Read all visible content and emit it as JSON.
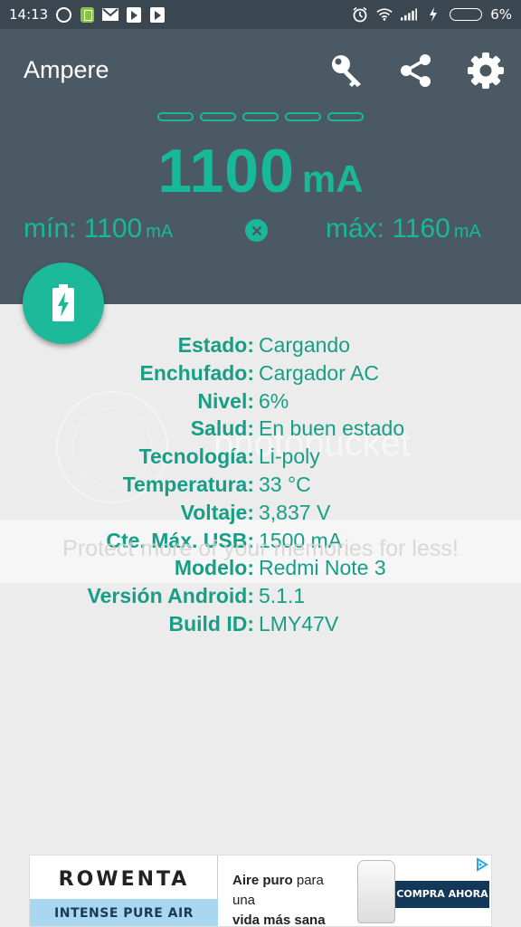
{
  "status_bar": {
    "time": "14:13",
    "battery_percent": "6%"
  },
  "app": {
    "title": "Ampere"
  },
  "current": {
    "value": "1100",
    "unit": "mA",
    "min_label": "mín: 1100",
    "max_label": "máx: 1160",
    "min_unit": "mA",
    "max_unit": "mA",
    "segments_lit": 0,
    "segments_total": 5
  },
  "info_rows": [
    {
      "label": "Estado:",
      "value": "Cargando"
    },
    {
      "label": "Enchufado:",
      "value": "Cargador AC"
    },
    {
      "label": "Nivel:",
      "value": "6%"
    },
    {
      "label": "Salud:",
      "value": "En buen estado"
    },
    {
      "label": "Tecnología:",
      "value": "Li-poly"
    },
    {
      "label": "Temperatura:",
      "value": "33 °C"
    },
    {
      "label": "Voltaje:",
      "value": "3,837 V"
    },
    {
      "label": "Cte. Máx. USB:",
      "value": "1500 mA"
    },
    {
      "label": "Modelo:",
      "value": "Redmi Note 3"
    },
    {
      "label": "Versión Android:",
      "value": "5.1.1"
    },
    {
      "label": "Build ID:",
      "value": "LMY47V"
    }
  ],
  "watermark": {
    "brand": "photobucket",
    "tagline": "Protect more of your memories for less!"
  },
  "ad": {
    "brand": "ROWENTA",
    "product_line": "INTENSE PURE AIR",
    "copy_line1_bold": "Aire puro",
    "copy_line1_rest": " para una",
    "copy_line2": "vida más sana",
    "cta": "COMPRA AHORA"
  },
  "colors": {
    "accent": "#18b89a",
    "header_bg": "#4a5964",
    "status_bg": "#3b4750",
    "body_bg": "#ececec"
  }
}
